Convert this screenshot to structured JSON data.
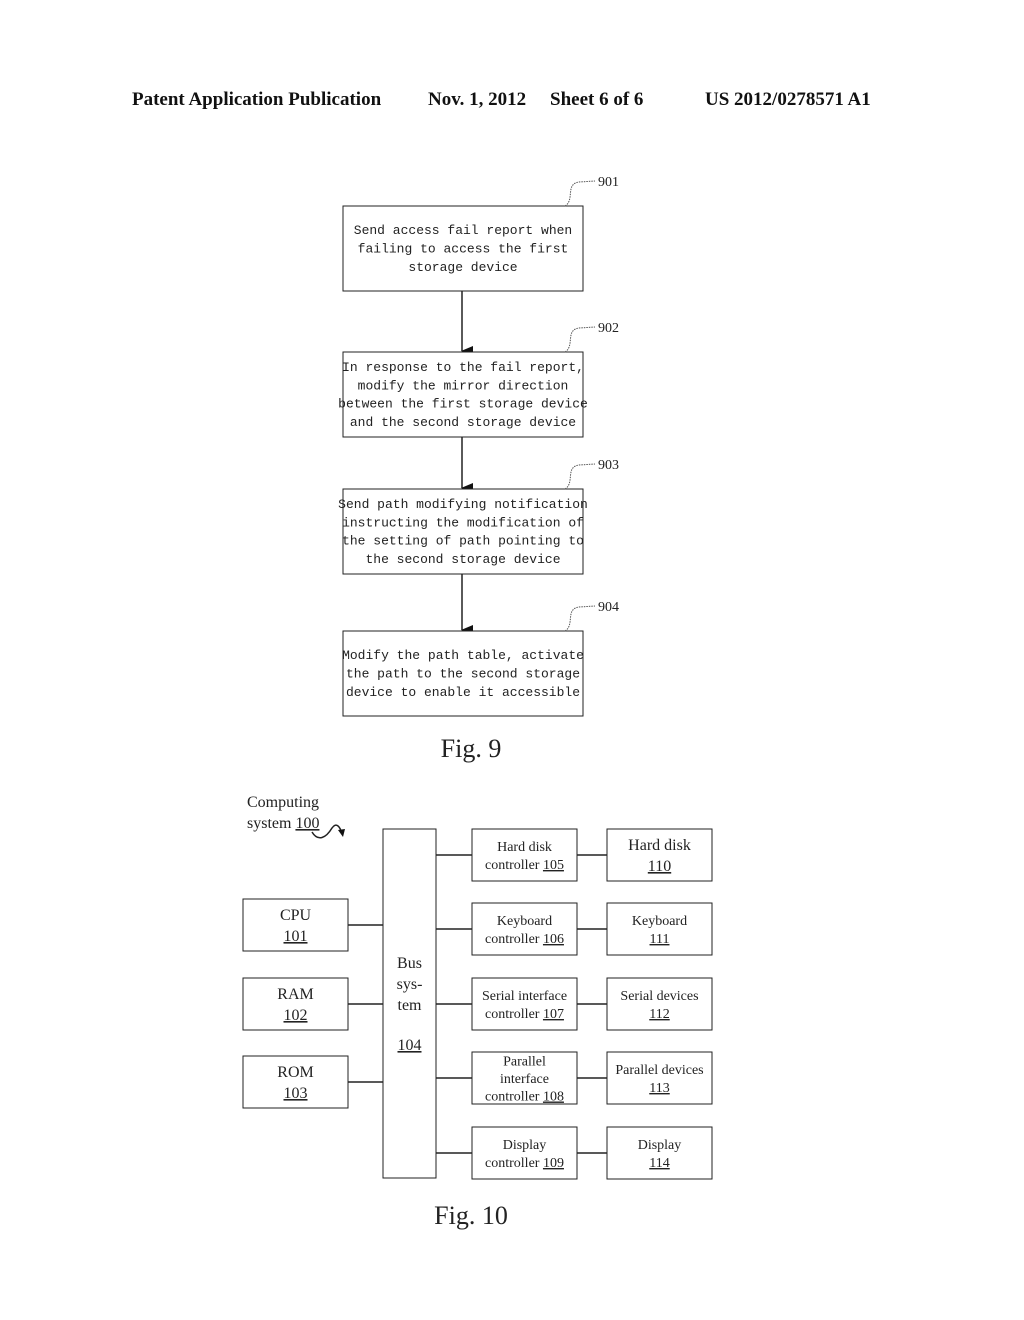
{
  "header": {
    "publication_type": "Patent Application Publication",
    "date": "Nov. 1, 2012",
    "sheet": "Sheet 6 of 6",
    "number": "US 2012/0278571 A1"
  },
  "fig9": {
    "caption": "Fig. 9",
    "steps": [
      {
        "ref": "901",
        "lines": [
          "Send access fail report when",
          "failing to access the first",
          "storage device"
        ]
      },
      {
        "ref": "902",
        "lines": [
          "In response to the fail report,",
          "modify the mirror direction",
          "between the first storage device",
          "and the second storage device"
        ]
      },
      {
        "ref": "903",
        "lines": [
          "Send path modifying notification",
          "instructing the modification of",
          "the setting of path pointing to",
          "the second storage device"
        ]
      },
      {
        "ref": "904",
        "lines": [
          "Modify the path table, activate",
          "the path to the second storage",
          "device to enable it accessible"
        ]
      }
    ]
  },
  "fig10": {
    "caption": "Fig. 10",
    "system_label": [
      "Computing",
      "system "
    ],
    "system_ref": "100",
    "left_blocks": [
      {
        "name": "CPU",
        "ref": "101"
      },
      {
        "name": "RAM",
        "ref": "102"
      },
      {
        "name": "ROM",
        "ref": "103"
      }
    ],
    "bus": {
      "lines": [
        "Bus",
        "sys-",
        "tem"
      ],
      "ref": "104"
    },
    "controllers": [
      {
        "lines": [
          "Hard disk",
          "controller "
        ],
        "ref": "105"
      },
      {
        "lines": [
          "Keyboard",
          "controller "
        ],
        "ref": "106"
      },
      {
        "lines": [
          "Serial interface",
          "controller "
        ],
        "ref": "107"
      },
      {
        "lines": [
          "Parallel",
          "interface",
          "controller "
        ],
        "ref": "108"
      },
      {
        "lines": [
          "Display",
          "controller "
        ],
        "ref": "109"
      }
    ],
    "devices": [
      {
        "name": "Hard disk",
        "ref": "110"
      },
      {
        "name": "Keyboard",
        "ref": "111"
      },
      {
        "name": "Serial devices",
        "ref": "112"
      },
      {
        "name": "Parallel devices",
        "ref": "113"
      },
      {
        "name": "Display",
        "ref": "114"
      }
    ]
  }
}
